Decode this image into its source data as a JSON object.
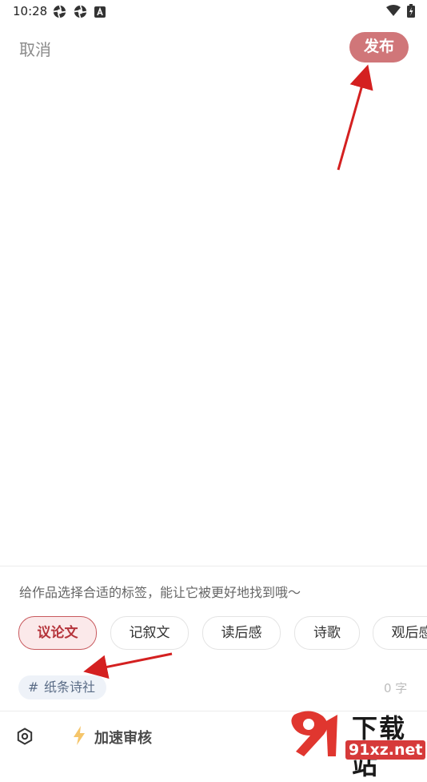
{
  "status_bar": {
    "time": "10:28",
    "icons": [
      "aperture-icon",
      "aperture-icon",
      "a-square-icon",
      "wifi-icon",
      "battery-icon"
    ]
  },
  "header": {
    "cancel_label": "取消",
    "publish_label": "发布"
  },
  "editor": {
    "placeholder": ""
  },
  "tags": {
    "hint": "给作品选择合适的标签，能让它被更好地找到哦～",
    "items": [
      {
        "label": "议论文",
        "selected": true
      },
      {
        "label": "记叙文",
        "selected": false
      },
      {
        "label": "读后感",
        "selected": false
      },
      {
        "label": "诗歌",
        "selected": false
      },
      {
        "label": "观后感",
        "selected": false
      }
    ]
  },
  "topic": {
    "hash": "#",
    "label": "纸条诗社"
  },
  "word_count": "0 字",
  "bottom_bar": {
    "speed_review_label": "加速审核"
  },
  "watermark": {
    "title": "下载站",
    "url": "91xz.net"
  },
  "colors": {
    "accent": "#d07679",
    "selected_tag_bg": "#fbe9ea",
    "selected_tag_text": "#b5343b",
    "annotation_arrow": "#d42020"
  }
}
